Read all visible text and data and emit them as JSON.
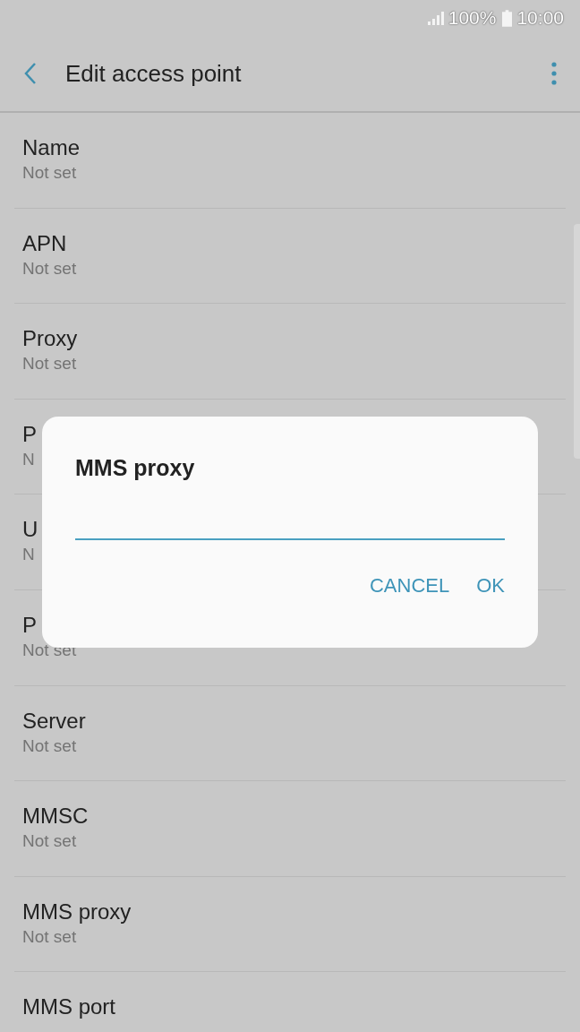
{
  "status_bar": {
    "battery": "100%",
    "time": "10:00"
  },
  "toolbar": {
    "title": "Edit access point"
  },
  "settings": [
    {
      "title": "Name",
      "value": "Not set"
    },
    {
      "title": "APN",
      "value": "Not set"
    },
    {
      "title": "Proxy",
      "value": "Not set"
    },
    {
      "title": "P",
      "value": "N"
    },
    {
      "title": "U",
      "value": "N"
    },
    {
      "title": "P",
      "value": "Not set"
    },
    {
      "title": "Server",
      "value": "Not set"
    },
    {
      "title": "MMSC",
      "value": "Not set"
    },
    {
      "title": "MMS proxy",
      "value": "Not set"
    },
    {
      "title": "MMS port"
    }
  ],
  "dialog": {
    "title": "MMS proxy",
    "buttons": [
      "CANCEL",
      "OK"
    ]
  }
}
